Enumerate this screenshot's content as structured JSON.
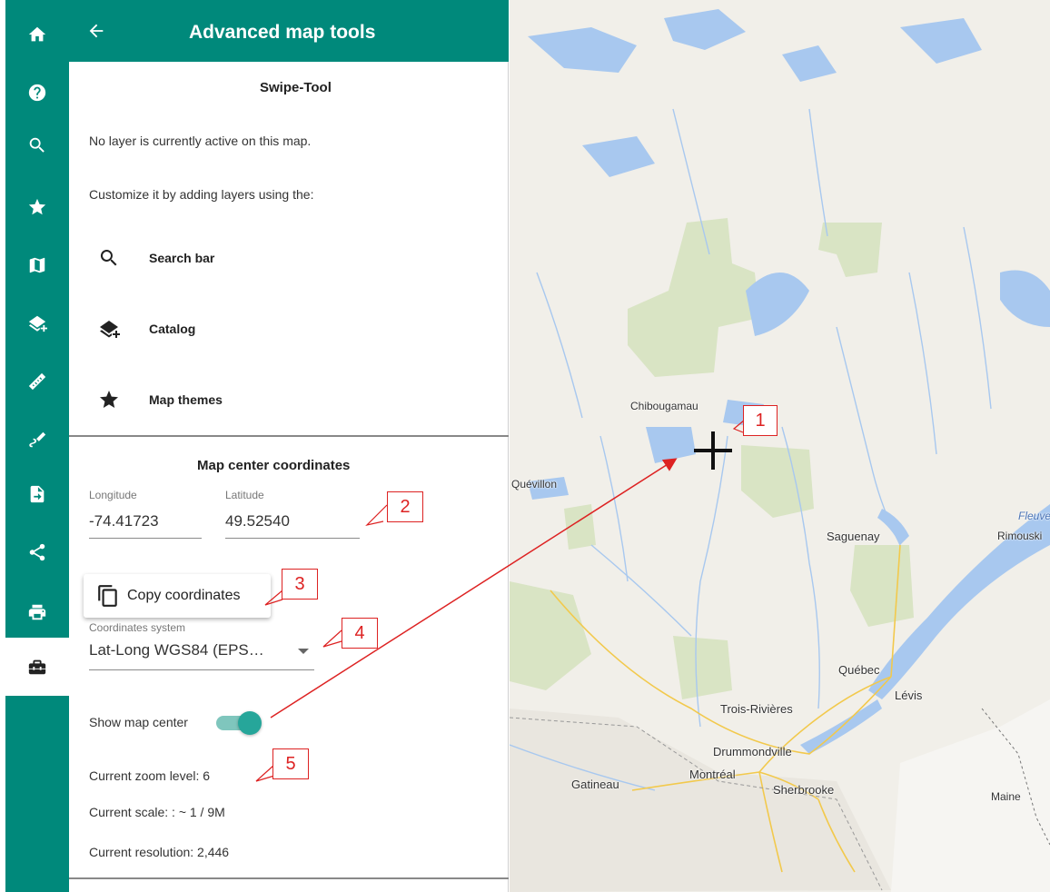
{
  "iconbar": {
    "items": [
      {
        "icon": "home-icon"
      },
      {
        "icon": "help-icon"
      },
      {
        "icon": "search-icon"
      },
      {
        "icon": "star-icon"
      },
      {
        "icon": "map-icon"
      },
      {
        "icon": "layers-add-icon"
      },
      {
        "icon": "ruler-icon"
      },
      {
        "icon": "directions-icon"
      },
      {
        "icon": "import-export-icon"
      },
      {
        "icon": "share-icon"
      },
      {
        "icon": "print-icon"
      },
      {
        "icon": "toolbox-icon",
        "active": true
      }
    ]
  },
  "panel": {
    "title": "Advanced map tools",
    "swipe": {
      "title": "Swipe-Tool",
      "no_layer_text": "No layer is currently active on this map.",
      "customize_text": "Customize it by adding layers using the:",
      "items": [
        {
          "label": "Search bar",
          "icon": "search-icon"
        },
        {
          "label": "Catalog",
          "icon": "layers-add-icon"
        },
        {
          "label": "Map themes",
          "icon": "star-icon"
        }
      ]
    },
    "center": {
      "title": "Map center coordinates",
      "longitude_label": "Longitude",
      "longitude_value": "-74.41723",
      "latitude_label": "Latitude",
      "latitude_value": "49.52540",
      "copy_label": "Copy coordinates",
      "system_label": "Coordinates system",
      "system_value": "Lat-Long WGS84 (EPS…",
      "show_center_label": "Show map center",
      "show_center_on": true,
      "zoom_text": "Current zoom level: 6",
      "scale_text": "Current scale: : ~ 1 / 9M",
      "resolution_text": "Current resolution: 2,446"
    }
  },
  "map": {
    "cities": [
      "Chibougamau",
      "Quévillon",
      "Saguenay",
      "Rimouski",
      "Fleuve",
      "Québec",
      "Lévis",
      "Trois-Rivières",
      "Drummondville",
      "Montréal",
      "Sherbrooke",
      "Gatineau",
      "Maine"
    ]
  },
  "callouts": [
    "1",
    "2",
    "3",
    "4",
    "5"
  ],
  "colors": {
    "accent": "#00897b",
    "annotation": "#dd2222",
    "water": "#a8c8ef",
    "forest": "#d9e4c4"
  }
}
